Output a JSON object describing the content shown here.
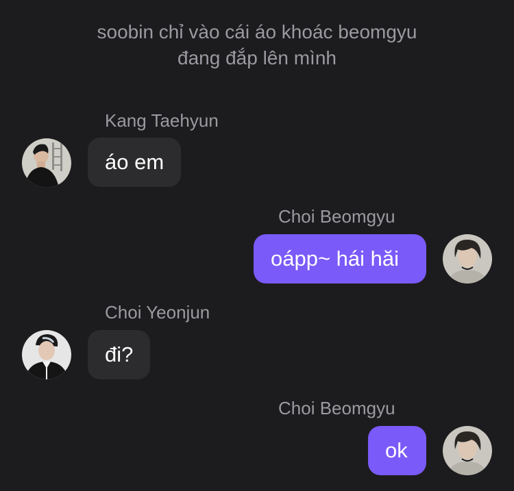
{
  "system_note": {
    "line1": "soobin chỉ vào cái áo khoác beomgyu",
    "line2": "đang đắp lên mình"
  },
  "messages": [
    {
      "sender": "Kang Taehyun",
      "text": "áo em",
      "direction": "incoming"
    },
    {
      "sender": "Choi Beomgyu",
      "text": "oápp~ hái hăi",
      "direction": "outgoing"
    },
    {
      "sender": "Choi Yeonjun",
      "text": "đi?",
      "direction": "incoming"
    },
    {
      "sender": "Choi Beomgyu",
      "text": "ok",
      "direction": "outgoing"
    }
  ],
  "colors": {
    "background": "#1c1c1e",
    "incoming_bubble": "#2c2c2e",
    "outgoing_bubble": "#7a5af8",
    "muted_text": "#9a9aa0"
  }
}
